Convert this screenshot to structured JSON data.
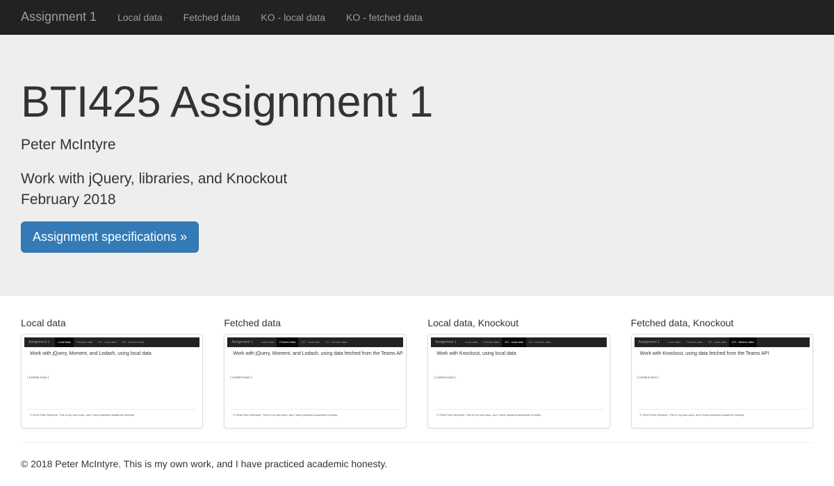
{
  "navbar": {
    "brand": "Assignment 1",
    "links": [
      "Local data",
      "Fetched data",
      "KO - local data",
      "KO - fetched data"
    ]
  },
  "jumbotron": {
    "title": "BTI425 Assignment 1",
    "author": "Peter McIntyre",
    "description": "Work with jQuery, libraries, and Knockout",
    "date": "February 2018",
    "button_label": "Assignment specifications »"
  },
  "cards": [
    {
      "title": "Local data",
      "thumb_lead": "Work with jQuery, Moment, and Lodash, using local data",
      "thumb_placeholder": "( content soon )",
      "thumb_footer": "© 2018 Peter McIntyre. This is my own work, and I have practiced academic honesty."
    },
    {
      "title": "Fetched data",
      "thumb_lead": "Work with jQuery, Moment, and Lodash, using data fetched from the Teams API",
      "thumb_placeholder": "( content soon )",
      "thumb_footer": "© 2018 Peter McIntyre. This is my own work, and I have practiced academic honesty."
    },
    {
      "title": "Local data, Knockout",
      "thumb_lead": "Work with Knockout, using local data",
      "thumb_placeholder": "( content soon )",
      "thumb_footer": "© 2018 Peter McIntyre. This is my own work, and I have practiced academic honesty."
    },
    {
      "title": "Fetched data, Knockout",
      "thumb_lead": "Work with Knockout, using data fetched from the Teams API",
      "thumb_placeholder": "( content soon )",
      "thumb_footer": "© 2018 Peter McIntyre. This is my own work, and I have practiced academic honesty."
    }
  ],
  "footer": {
    "text": "© 2018 Peter McIntyre. This is my own work, and I have practiced academic honesty."
  },
  "colors": {
    "navbar_bg": "#222222",
    "nav_text": "#9d9d9d",
    "jumbotron_bg": "#eeeeee",
    "primary_button": "#337ab7",
    "text": "#333333"
  }
}
